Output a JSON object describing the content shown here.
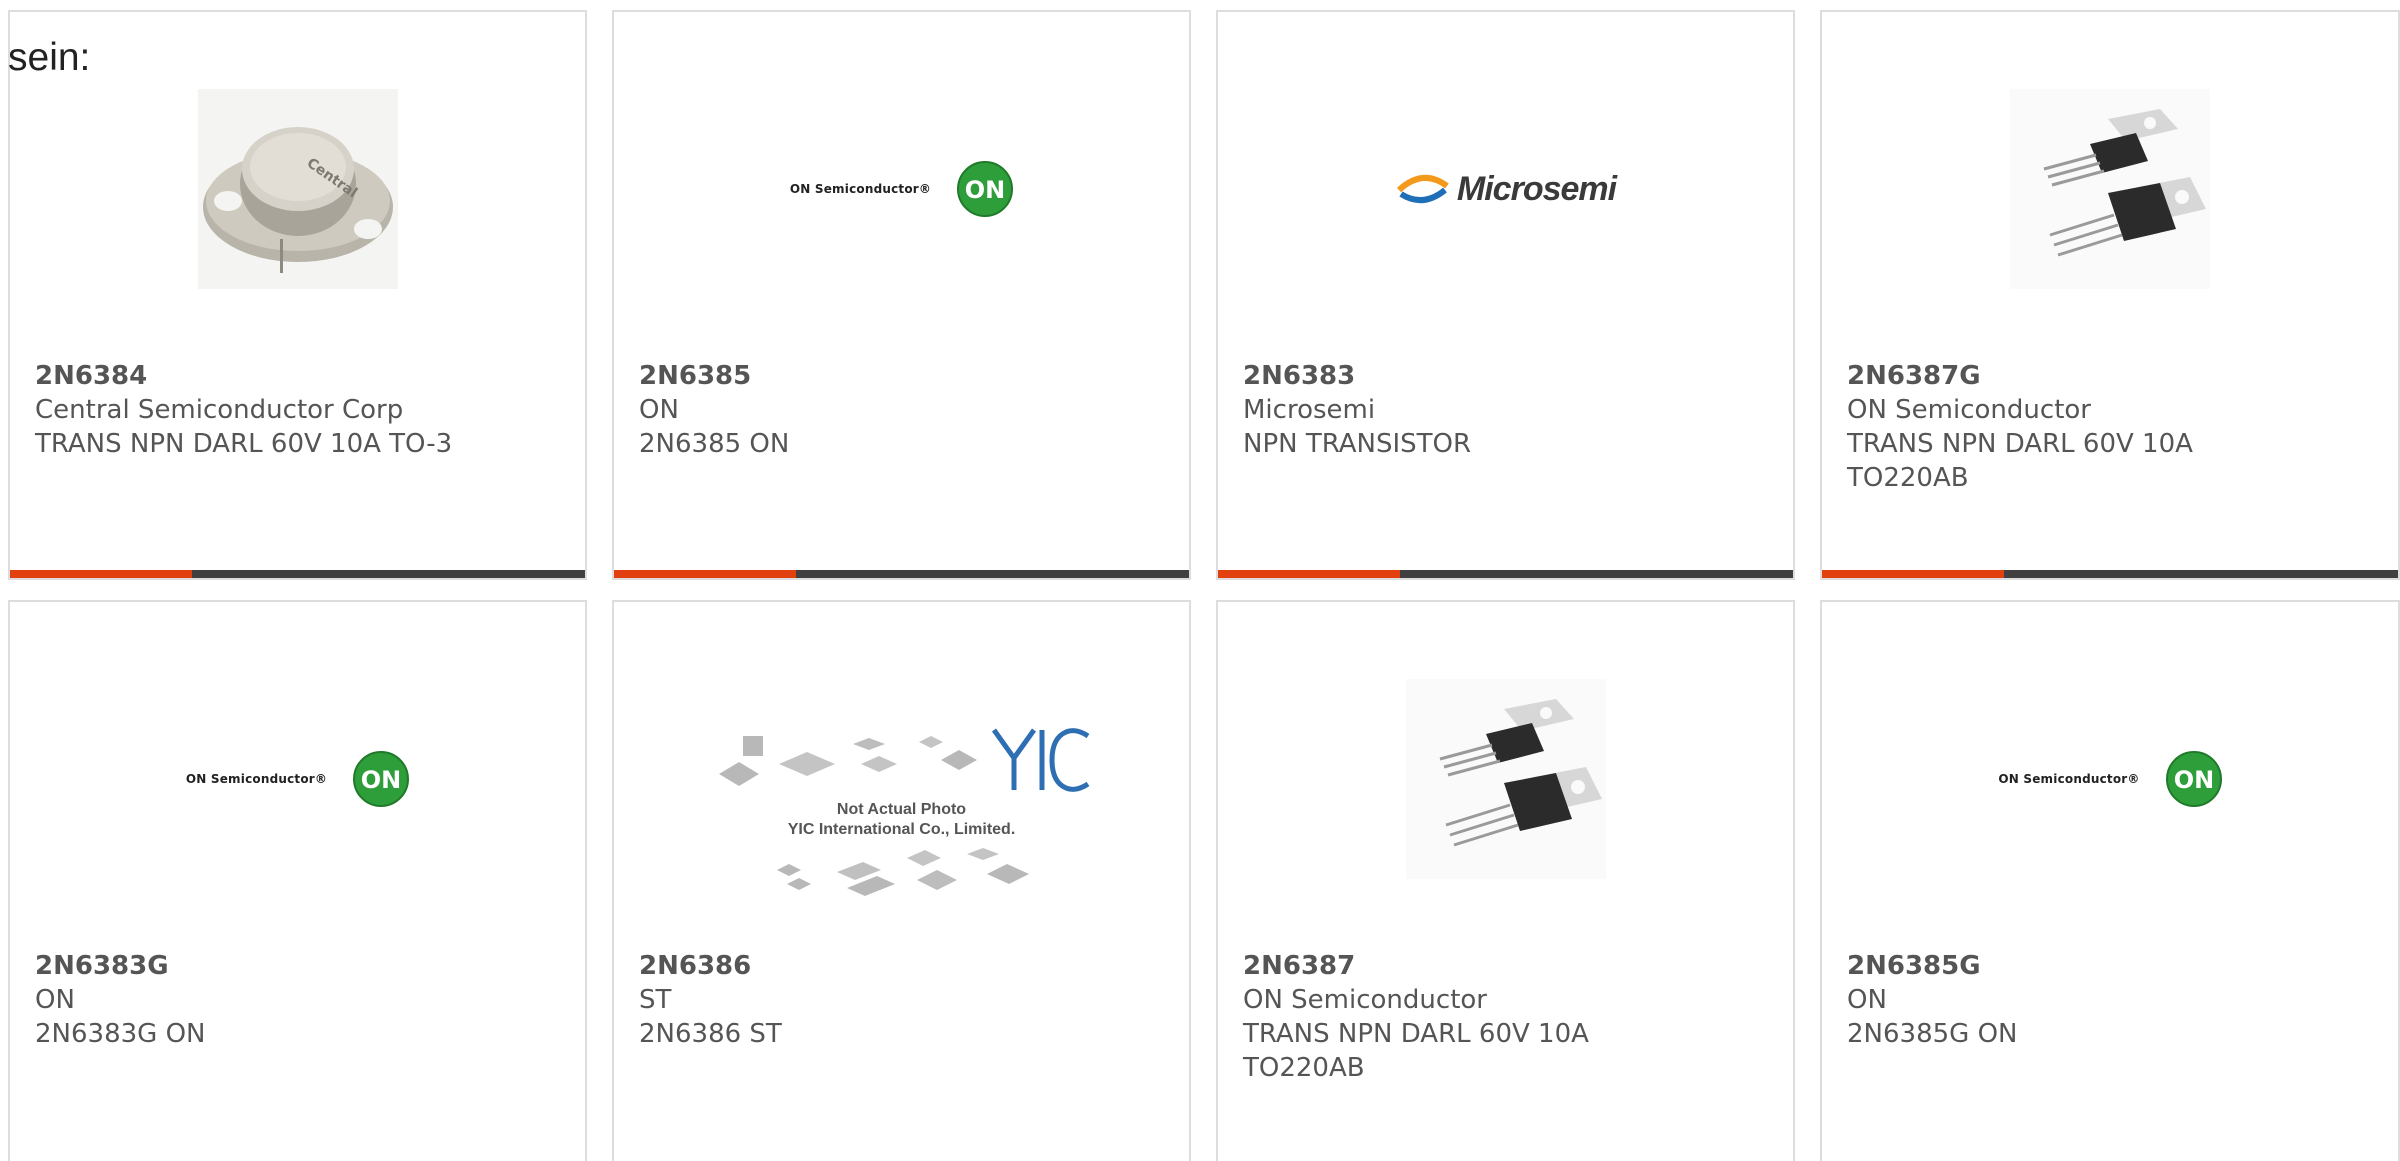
{
  "intro_text": "sein:",
  "cards": [
    {
      "part": "2N6384",
      "manufacturer": "Central Semiconductor Corp",
      "description": "TRANS NPN DARL 60V 10A TO-3",
      "image": "to3-transistor-photo"
    },
    {
      "part": "2N6385",
      "manufacturer": "ON",
      "description": "2N6385 ON",
      "image": "on-semiconductor-logo",
      "logo_text": "ON Semiconductor®",
      "logo_badge": "ON"
    },
    {
      "part": "2N6383",
      "manufacturer": "Microsemi",
      "description": "NPN TRANSISTOR",
      "image": "microsemi-logo",
      "logo_text": "Microsemi"
    },
    {
      "part": "2N6387G",
      "manufacturer": "ON Semiconductor",
      "description": "TRANS NPN DARL 60V 10A TO220AB",
      "image": "to220-transistor-photo"
    },
    {
      "part": "2N6383G",
      "manufacturer": "ON",
      "description": "2N6383G ON",
      "image": "on-semiconductor-logo",
      "logo_text": "ON Semiconductor®",
      "logo_badge": "ON"
    },
    {
      "part": "2N6386",
      "manufacturer": "ST",
      "description": "2N6386 ST",
      "image": "yic-placeholder",
      "logo_text": "YIC",
      "caption_line1": "Not Actual Photo",
      "caption_line2": "YIC International Co., Limited."
    },
    {
      "part": "2N6387",
      "manufacturer": "ON Semiconductor",
      "description": "TRANS NPN DARL 60V 10A TO220AB",
      "image": "to220-transistor-photo"
    },
    {
      "part": "2N6385G",
      "manufacturer": "ON",
      "description": "2N6385G ON",
      "image": "on-semiconductor-logo",
      "logo_text": "ON Semiconductor®",
      "logo_badge": "ON"
    }
  ],
  "colors": {
    "accent": "#e2400f",
    "bar": "#404040",
    "text": "#555555",
    "border": "#dddddd",
    "on_green": "#2e9e3a"
  }
}
